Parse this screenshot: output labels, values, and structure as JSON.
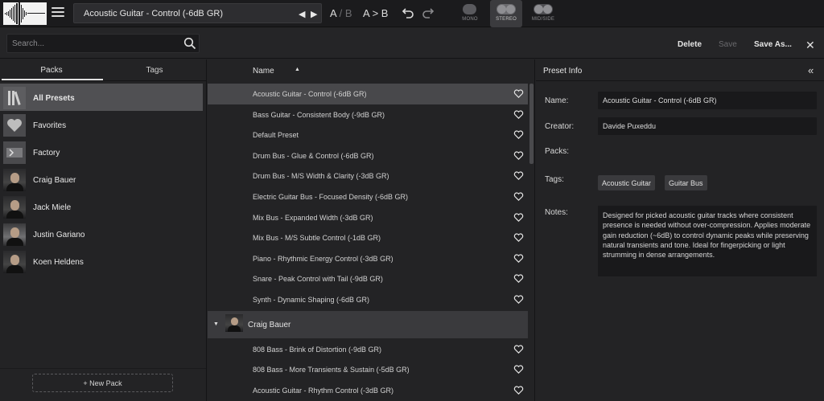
{
  "topbar": {
    "preset_name": "Acoustic Guitar - Control (-6dB GR)",
    "prev_arrow": "◀",
    "next_arrow": "▶",
    "ab_a": "A",
    "ab_sep": "/",
    "ab_b": "B",
    "copy_ab": "A > B",
    "modes": [
      {
        "label": "MONO",
        "active": false
      },
      {
        "label": "STEREO",
        "active": true
      },
      {
        "label": "MID/SIDE",
        "active": false
      }
    ]
  },
  "toolbar": {
    "search_placeholder": "Search...",
    "delete_label": "Delete",
    "save_label": "Save",
    "save_as_label": "Save As...",
    "close_label": "✕"
  },
  "left": {
    "tabs": [
      "Packs",
      "Tags"
    ],
    "active_tab": "Packs",
    "packs": [
      {
        "name": "All Presets",
        "icon": "library-icon",
        "selected": true
      },
      {
        "name": "Favorites",
        "icon": "heart-icon",
        "selected": false
      },
      {
        "name": "Factory",
        "icon": "factory-icon",
        "selected": false
      },
      {
        "name": "Craig Bauer",
        "icon": "avatar",
        "selected": false
      },
      {
        "name": "Jack Miele",
        "icon": "avatar",
        "selected": false
      },
      {
        "name": "Justin Gariano",
        "icon": "avatar",
        "selected": false
      },
      {
        "name": "Koen Heldens",
        "icon": "avatar",
        "selected": false
      }
    ],
    "new_pack_label": "+ New Pack"
  },
  "list": {
    "column_header": "Name",
    "sort_indicator": "▲",
    "presets": [
      "Acoustic Guitar - Control (-6dB GR)",
      "Bass Guitar - Consistent Body (-9dB GR)",
      "Default Preset",
      "Drum Bus - Glue & Control (-6dB GR)",
      "Drum Bus - M/S Width & Clarity (-3dB GR)",
      "Electric Guitar Bus - Focused Density (-6dB GR)",
      "Mix Bus - Expanded Width (-3dB GR)",
      "Mix Bus - M/S Subtle Control (-1dB GR)",
      "Piano - Rhythmic Energy Control (-3dB GR)",
      "Snare - Peak Control with Tail (-9dB GR)",
      "Synth - Dynamic Shaping (-6dB GR)"
    ],
    "group": {
      "name": "Craig Bauer",
      "expander": "▼",
      "presets": [
        "808 Bass - Brink of Distortion (-9dB GR)",
        "808 Bass - More Transients & Sustain (-5dB GR)",
        "Acoustic Guitar - Rhythm Control (-3dB GR)"
      ]
    }
  },
  "info": {
    "title": "Preset Info",
    "collapse_icon": "«",
    "name_label": "Name:",
    "name_value": "Acoustic Guitar - Control (-6dB GR)",
    "creator_label": "Creator:",
    "creator_value": "Davide Puxeddu",
    "packs_label": "Packs:",
    "tags_label": "Tags:",
    "tags": [
      "Acoustic Guitar",
      "Guitar Bus"
    ],
    "notes_label": "Notes:",
    "notes_value": "Designed for picked acoustic guitar tracks where consistent presence is needed without over-compression. Applies moderate gain reduction (~6dB) to control dynamic peaks while preserving natural transients and tone. Ideal for fingerpicking or light strumming in dense arrangements."
  }
}
